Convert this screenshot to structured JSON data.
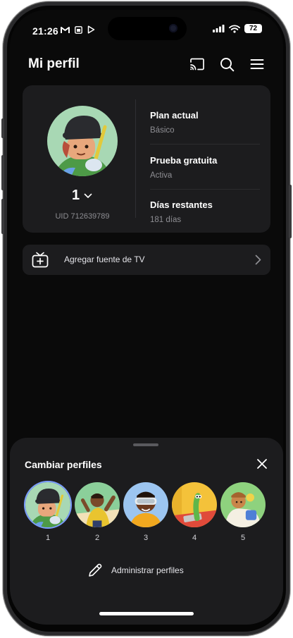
{
  "status_bar": {
    "time": "21:26",
    "battery": "72"
  },
  "header": {
    "title": "Mi perfil"
  },
  "profile": {
    "name": "1",
    "uid": "UID 712639789",
    "plan_label": "Plan actual",
    "plan_value": "Básico",
    "trial_label": "Prueba gratuita",
    "trial_value": "Activa",
    "days_label": "Días restantes",
    "days_value": "181 días"
  },
  "tv_source": {
    "label": "Agregar fuente de TV"
  },
  "sheet": {
    "title": "Cambiar perfiles",
    "profiles": [
      {
        "num": "1",
        "selected": true
      },
      {
        "num": "2"
      },
      {
        "num": "3"
      },
      {
        "num": "4"
      },
      {
        "num": "5"
      }
    ],
    "manage_label": "Administrar perfiles"
  },
  "colors": {
    "background": "#0a0a0a",
    "card": "#1c1c1e",
    "secondary_text": "#8e8e93",
    "selection_ring": "#7a9cff"
  }
}
